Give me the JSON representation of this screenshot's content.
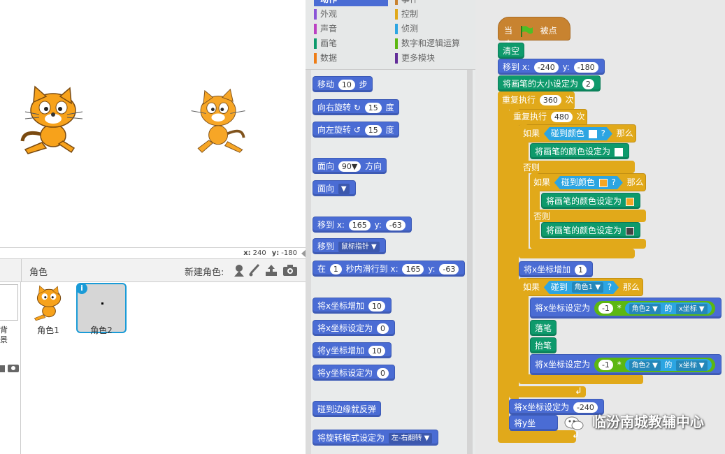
{
  "stage": {
    "coord_x_label": "x:",
    "coord_x_value": "240",
    "coord_y_label": "y:",
    "coord_y_value": "-180"
  },
  "sprites": {
    "header_label": "角色",
    "new_sprite_label": "新建角色:",
    "items": [
      {
        "name": "角色1"
      },
      {
        "name": "角色2"
      }
    ],
    "left_text_1": "背",
    "left_text_2": "景"
  },
  "categories": [
    {
      "label": "动作",
      "color": "#4a6cd4"
    },
    {
      "label": "事件",
      "color": "#c88330"
    },
    {
      "label": "外观",
      "color": "#8a55d7"
    },
    {
      "label": "控制",
      "color": "#e1a91a"
    },
    {
      "label": "声音",
      "color": "#bb42c3"
    },
    {
      "label": "侦测",
      "color": "#2ca5e2"
    },
    {
      "label": "画笔",
      "color": "#0e9a6c"
    },
    {
      "label": "数字和逻辑运算",
      "color": "#5cb712"
    },
    {
      "label": "数据",
      "color": "#ee7d16"
    },
    {
      "label": "更多模块",
      "color": "#632d99"
    }
  ],
  "palette": {
    "move": {
      "a": "移动",
      "v": "10",
      "b": "步"
    },
    "turn_right": {
      "a": "向右旋转",
      "v": "15",
      "b": "度"
    },
    "turn_left": {
      "a": "向左旋转",
      "v": "15",
      "b": "度"
    },
    "point_dir": {
      "a": "面向",
      "v": "90▼",
      "b": "方向"
    },
    "point_towards": {
      "a": "面向"
    },
    "goto_xy": {
      "a": "移到 x:",
      "x": "165",
      "b": "y:",
      "y": "-63"
    },
    "goto": {
      "a": "移到",
      "v": "鼠标指针"
    },
    "glide": {
      "a": "在",
      "t": "1",
      "b": "秒内滑行到 x:",
      "x": "165",
      "c": "y:",
      "y": "-63"
    },
    "change_x": {
      "a": "将x坐标增加",
      "v": "10"
    },
    "set_x": {
      "a": "将x坐标设定为",
      "v": "0"
    },
    "change_y": {
      "a": "将y坐标增加",
      "v": "10"
    },
    "set_y": {
      "a": "将y坐标设定为",
      "v": "0"
    },
    "bounce": {
      "a": "碰到边缘就反弹"
    },
    "rotation": {
      "a": "将旋转模式设定为",
      "v": "左-右翻转"
    }
  },
  "script": {
    "hat_a": "当",
    "hat_b": "被点击",
    "clear": "清空",
    "goto_a": "移到 x:",
    "goto_x": "-240",
    "goto_b": "y:",
    "goto_y": "-180",
    "pen_size_a": "将画笔的大小设定为",
    "pen_size_v": "2",
    "repeat1_a": "重复执行",
    "repeat1_v": "360",
    "repeat1_b": "次",
    "repeat2_a": "重复执行",
    "repeat2_v": "480",
    "repeat2_b": "次",
    "if1_a": "如果",
    "touch_color": "碰到颜色",
    "q": "?",
    "then": "那么",
    "set_pen_color": "将画笔的颜色设定为",
    "else": "否则",
    "if2_a": "如果",
    "change_x_a": "将x坐标增加",
    "change_x_v": "1",
    "if3_a": "如果",
    "touch": "碰到",
    "touch_sprite": "角色1",
    "set_x_a": "将x坐标设定为",
    "neg1": "-1",
    "times": "*",
    "of_sprite": "角色2",
    "of": "的",
    "x_pos": "x坐标",
    "pen_down": "落笔",
    "pen_up": "抬笔",
    "set_x_final_a": "将x坐标设定为",
    "set_x_final_v": "-240",
    "change_y_a": "将y坐",
    "colors": {
      "white": "#ffffff",
      "orange": "#f5a623",
      "dark": "#444444"
    }
  },
  "watermark": "临汾南城教辅中心"
}
